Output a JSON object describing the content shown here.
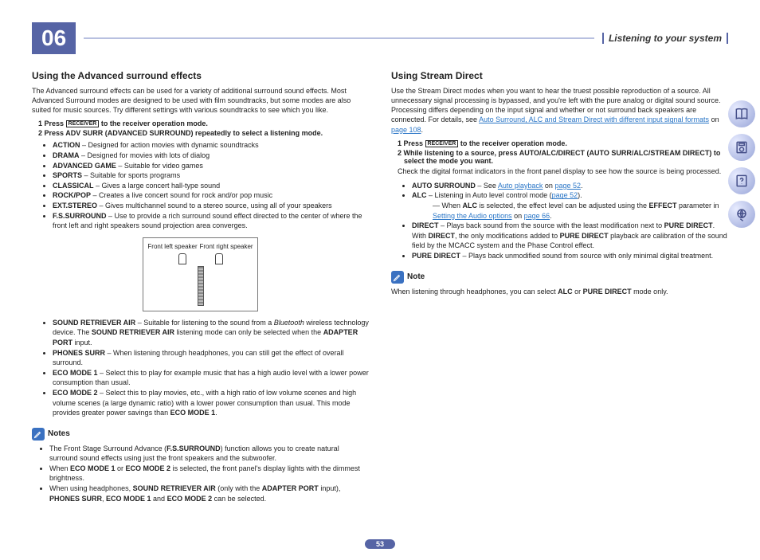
{
  "chapter_number": "06",
  "section_title": "Listening to your system",
  "page_number": "53",
  "left": {
    "heading": "Using the Advanced surround effects",
    "intro": "The Advanced surround effects can be used for a variety of additional surround sound effects. Most Advanced Surround modes are designed to be used with film soundtracks, but some modes are also suited for music sources. Try different settings with various soundtracks to see which you like.",
    "step1_pre": "1   Press ",
    "step1_btn": "RECEIVER",
    "step1_post": " to the receiver operation mode.",
    "step2": "2   Press ADV SURR (ADVANCED SURROUND) repeatedly to select a listening mode.",
    "modes1": [
      {
        "n": "ACTION",
        "d": " – Designed for action movies with dynamic soundtracks"
      },
      {
        "n": "DRAMA",
        "d": " – Designed for movies with lots of dialog"
      },
      {
        "n": "ADVANCED GAME",
        "d": " – Suitable for video games"
      },
      {
        "n": "SPORTS",
        "d": " – Suitable for sports programs"
      },
      {
        "n": "CLASSICAL",
        "d": " – Gives a large concert hall-type sound"
      },
      {
        "n": "ROCK/POP",
        "d": " – Creates a live concert sound for rock and/or pop music"
      },
      {
        "n": "EXT.STEREO",
        "d": " – Gives multichannel sound to a stereo source, using all of your speakers"
      },
      {
        "n": "F.S.SURROUND",
        "d": " – Use to provide a rich surround sound effect directed to the center of where the front left and right speakers sound projection area converges."
      }
    ],
    "fig_label_l": "Front left speaker",
    "fig_label_r": "Front right speaker",
    "modes2": [
      {
        "html": "<b>SOUND RETRIEVER AIR</b> – Suitable for listening to the sound from a <i>Bluetooth</i> wireless technology device. The <b>SOUND RETRIEVER AIR</b> listening mode can only be selected when the <b>ADAPTER PORT</b> input."
      },
      {
        "html": "<b>PHONES SURR</b> – When listening through headphones, you can still get the effect of overall surround."
      },
      {
        "html": "<b>ECO MODE 1</b> – Select this to play for example music that has a high audio level with a lower power consumption than usual."
      },
      {
        "html": "<b>ECO MODE 2</b> – Select this to play movies, etc., with a high ratio of low volume scenes and high volume scenes (a large dynamic ratio) with a lower power consumption than usual. This mode provides greater power savings than <b>ECO MODE 1</b>."
      }
    ],
    "notes_label": "Notes",
    "notes": [
      "The Front Stage Surround Advance (<b>F.S.SURROUND</b>) function allows you to create natural surround sound effects using just the front speakers and the subwoofer.",
      "When <b>ECO MODE 1</b> or <b>ECO MODE 2</b> is selected, the front panel's display lights with the dimmest brightness.",
      "When using headphones, <b>SOUND RETRIEVER AIR</b> (only with the <b>ADAPTER PORT</b> input), <b>PHONES SURR</b>, <b>ECO MODE 1</b> and <b>ECO MODE 2</b> can be selected."
    ]
  },
  "right": {
    "heading": "Using Stream Direct",
    "intro_pre": "Use the Stream Direct modes when you want to hear the truest possible reproduction of a source. All unnecessary signal processing is bypassed, and you're left with the pure analog or digital sound source.\nProcessing differs depending on the input signal and whether or not surround back speakers are connected. For details, see ",
    "intro_link": "Auto Surround, ALC and Stream Direct with different input signal formats",
    "intro_on": " on ",
    "intro_page": "page 108",
    "step1_pre": "1   Press ",
    "step1_btn": "RECEIVER",
    "step1_post": " to the receiver operation mode.",
    "step2": "2   While listening to a source, press AUTO/ALC/DIRECT (AUTO SURR/ALC/STREAM DIRECT) to select the mode you want.",
    "step2_desc": "Check the digital format indicators in the front panel display to see how the source is being processed.",
    "modesA": {
      "n": "AUTO SURROUND",
      "pre": " – See ",
      "link": "Auto playback",
      "on": " on ",
      "page": "page 52"
    },
    "modesB": {
      "n": "ALC",
      "pre": " – Listening in Auto level control mode (",
      "page": "page 52",
      "post": ")."
    },
    "modesB_sub_pre": "When ",
    "modesB_sub_alc": "ALC",
    "modesB_sub_mid": " is selected, the effect level can be adjusted using the ",
    "modesB_sub_eff": "EFFECT",
    "modesB_sub_par": " parameter in ",
    "modesB_sub_link": "Setting the Audio options",
    "modesB_sub_on": " on ",
    "modesB_sub_page": "page 66",
    "modesC": "<b>DIRECT</b> – Plays back sound from the source with the least modification next to <b>PURE DIRECT</b>. With <b>DIRECT</b>, the only modifications added to <b>PURE DIRECT</b> playback are calibration of the sound field by the MCACC system and the Phase Control effect.",
    "modesD": "<b>PURE DIRECT</b> – Plays back unmodified sound from source with only minimal digital treatment.",
    "note_label": "Note",
    "note_body": "When listening through headphones, you can select <b>ALC</b> or <b>PURE DIRECT</b> mode only."
  }
}
